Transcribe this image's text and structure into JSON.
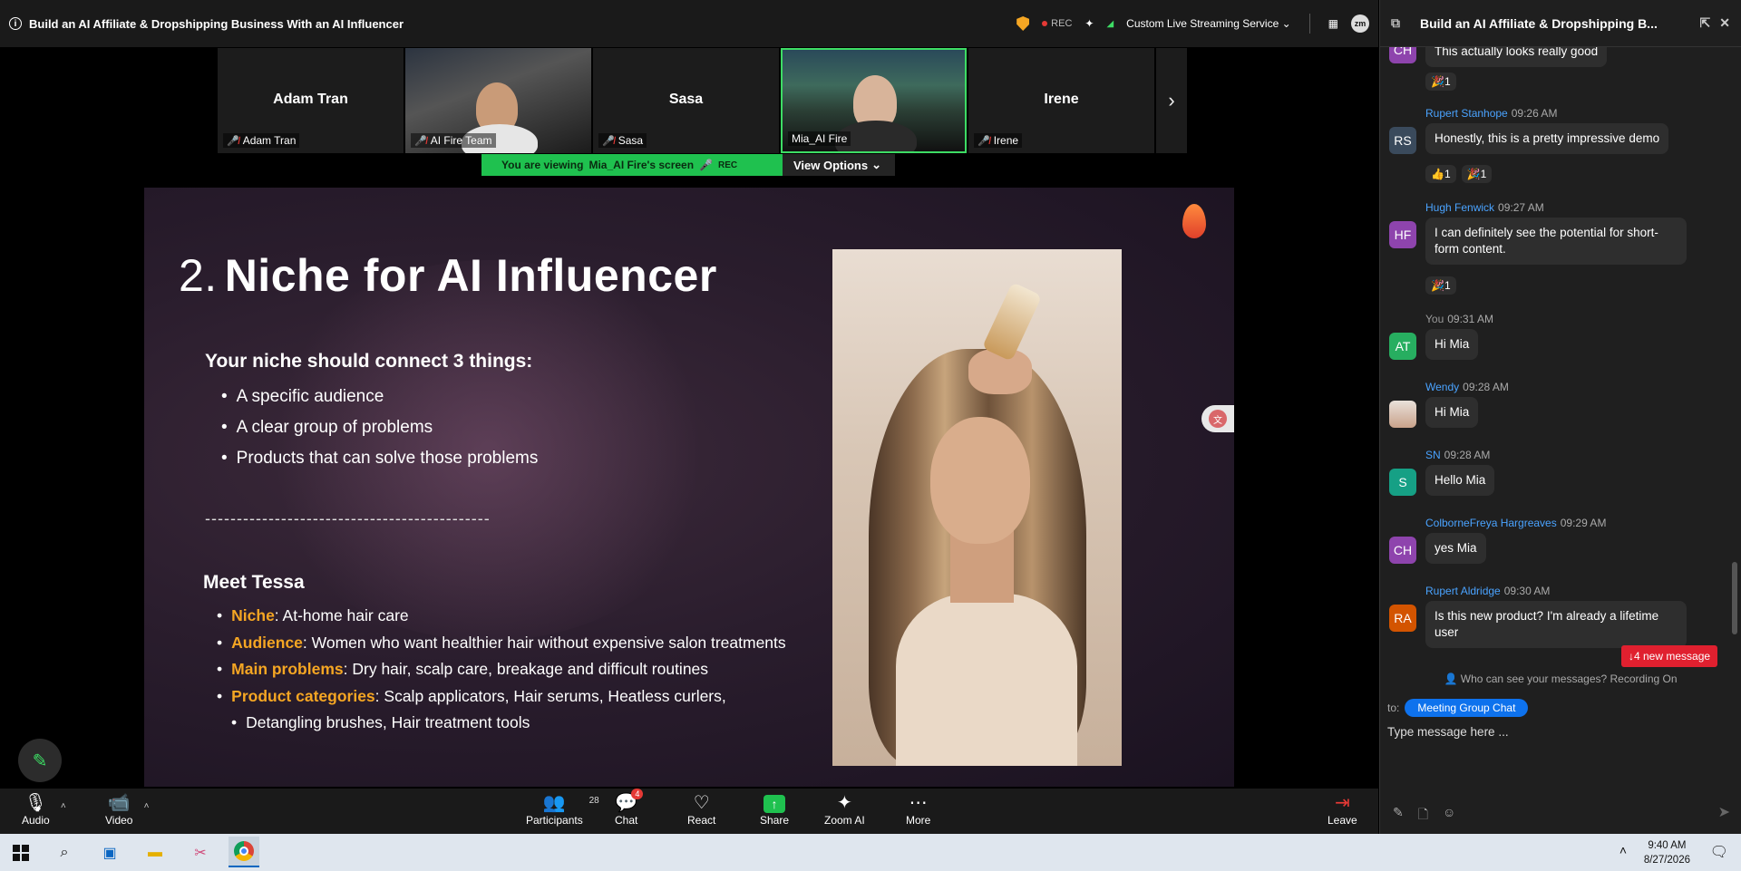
{
  "window": {
    "title": "Build an AI Affiliate & Dropshipping Business With an AI Influencer",
    "rec": "REC",
    "streaming": "Custom Live Streaming Service",
    "app_badge": "zm"
  },
  "participants_strip": [
    {
      "big_name": "Adam Tran",
      "label": "Adam Tran",
      "muted": true,
      "video": false
    },
    {
      "big_name": "",
      "label": "AI Fire Team",
      "muted": true,
      "video": true
    },
    {
      "big_name": "Sasa",
      "label": "Sasa",
      "muted": true,
      "video": false
    },
    {
      "big_name": "",
      "label": "Mia_AI Fire",
      "muted": false,
      "video": true,
      "active": true
    },
    {
      "big_name": "Irene",
      "label": "Irene",
      "muted": true,
      "video": false
    }
  ],
  "viewing": {
    "prefix": "You are viewing",
    "name": "Mia_AI Fire's screen",
    "rec": "REC",
    "options": "View Options"
  },
  "slide": {
    "number": "2.",
    "title": "Niche for AI Influencer",
    "subtitle": "Your niche should connect 3 things:",
    "list1": [
      "A specific audience",
      "A clear group of problems",
      "Products that can solve those problems"
    ],
    "divider": "---------------------------------------------",
    "meet": "Meet Tessa",
    "details": [
      {
        "key": "Niche",
        "value": ": At-home hair care"
      },
      {
        "key": "Audience",
        "value": ": Women who want healthier hair without expensive salon treatments"
      },
      {
        "key": "Main problems",
        "value": ": Dry hair, scalp care, breakage and difficult routines"
      },
      {
        "key": "Product categories",
        "value": ": Scalp applicators, Hair serums, Heatless curlers,"
      }
    ],
    "details_cont": "Detangling brushes, Hair treatment tools",
    "accent": "#f5a623"
  },
  "toolbar": {
    "audio": "Audio",
    "video": "Video",
    "participants": "Participants",
    "participants_count": "28",
    "chat": "Chat",
    "chat_badge": "4",
    "react": "React",
    "share": "Share",
    "zoom_ai": "Zoom AI",
    "more": "More",
    "leave": "Leave"
  },
  "chat": {
    "title": "Build an AI Affiliate & Dropshipping B...",
    "partial_top": "This actually looks really good",
    "messages": [
      {
        "sender": "Rupert Stanhope",
        "time": "09:26 AM",
        "initials": "RS",
        "color": "#3a4a5c",
        "text": "Honestly, this is a pretty impressive demo"
      },
      {
        "sender": "Hugh Fenwick",
        "time": "09:27 AM",
        "initials": "HF",
        "color": "#8e44ad",
        "text": "I can definitely see the potential for short-form content."
      },
      {
        "sender": "You",
        "time": "09:31 AM",
        "initials": "AT",
        "color": "#27ae60",
        "text": "Hi Mia"
      },
      {
        "sender": "Wendy",
        "time": "09:28 AM",
        "initials": "",
        "color": "#c9a28a",
        "text": "Hi Mia"
      },
      {
        "sender": "SN",
        "time": "09:28 AM",
        "initials": "S",
        "color": "#16a085",
        "text": "Hello Mia"
      },
      {
        "sender": "ColborneFreya Hargreaves",
        "time": "09:29 AM",
        "initials": "CH",
        "color": "#8e44ad",
        "text": "yes Mia"
      },
      {
        "sender": "Rupert Aldridge",
        "time": "09:30 AM",
        "initials": "RA",
        "color": "#d35400",
        "text": "Is this new product? I'm already a lifetime user"
      }
    ],
    "reactions": {
      "r1": "🎉1",
      "r2a": "👍1",
      "r2b": "🎉1",
      "r3": "🎉1"
    },
    "new_message": "↓4 new message",
    "who_can_see": "Who can see your messages? Recording On",
    "to_label": "to:",
    "to_target": "Meeting Group Chat",
    "placeholder": "Type message here ..."
  },
  "taskbar": {
    "time": "9:40 AM",
    "date": "8/27/2026"
  }
}
